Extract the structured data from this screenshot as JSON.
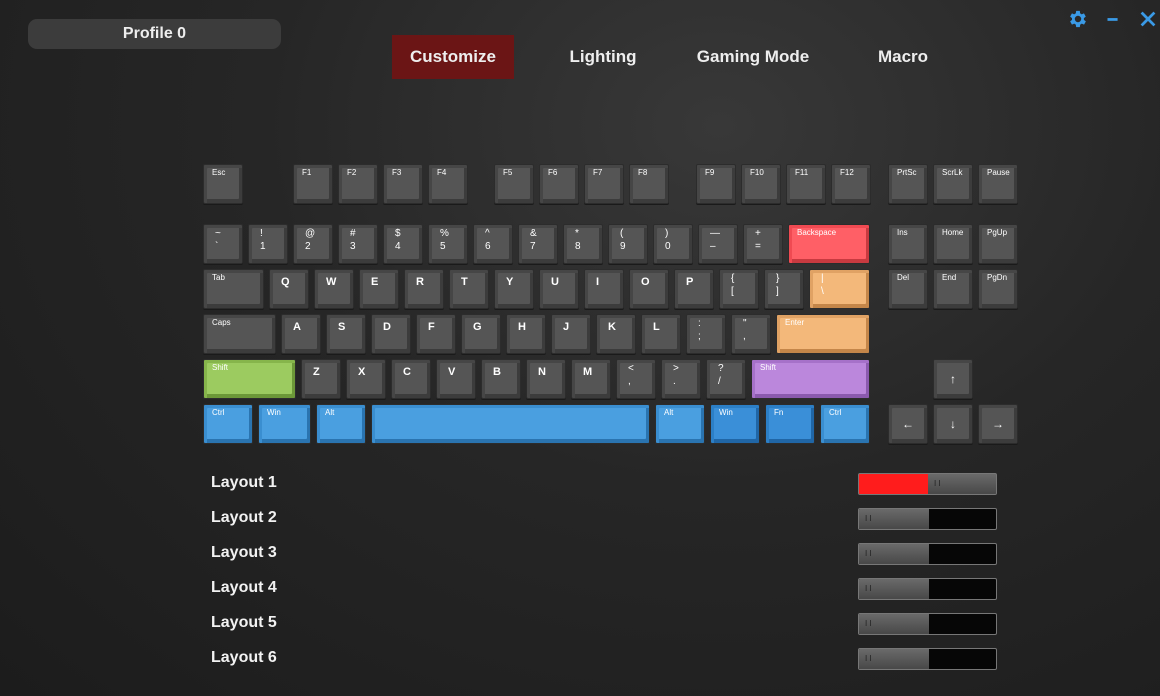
{
  "profile": {
    "name": "Profile 0"
  },
  "tabs": [
    {
      "label": "Customize",
      "active": true
    },
    {
      "label": "Lighting",
      "active": false
    },
    {
      "label": "Gaming Mode",
      "active": false
    },
    {
      "label": "Macro",
      "active": false
    }
  ],
  "window_controls": [
    "gear-icon",
    "minimize-icon",
    "close-icon"
  ],
  "colors": {
    "accent": "#6b1515",
    "toggle_on": "#ff1c1c",
    "backspace": "#ff5f66",
    "pipe_enter": "#f3b87a",
    "left_shift": "#9ccb60",
    "right_shift": "#bb87dc",
    "modifiers": "#4a9fe0"
  },
  "keyboard": {
    "function_row": [
      "Esc",
      "F1",
      "F2",
      "F3",
      "F4",
      "F5",
      "F6",
      "F7",
      "F8",
      "F9",
      "F10",
      "F11",
      "F12"
    ],
    "number_row": [
      [
        "~",
        "`"
      ],
      [
        "!",
        "1"
      ],
      [
        "@",
        "2"
      ],
      [
        "#",
        "3"
      ],
      [
        "$",
        "4"
      ],
      [
        "%",
        "5"
      ],
      [
        "^",
        "6"
      ],
      [
        "&",
        "7"
      ],
      [
        "*",
        "8"
      ],
      [
        "(",
        "9"
      ],
      [
        ")",
        "0"
      ],
      [
        "—",
        "–"
      ],
      [
        "+",
        "="
      ]
    ],
    "backspace": "Backspace",
    "tab_row": [
      "Tab",
      "Q",
      "W",
      "E",
      "R",
      "T",
      "Y",
      "U",
      "I",
      "O",
      "P"
    ],
    "brackets": [
      [
        "{",
        "["
      ],
      [
        "}",
        "]"
      ]
    ],
    "pipe": [
      "|",
      "\\"
    ],
    "caps_row": [
      "Caps",
      "A",
      "S",
      "D",
      "F",
      "G",
      "H",
      "J",
      "K",
      "L"
    ],
    "semicolon": [
      ":",
      ";"
    ],
    "quote": [
      "\"",
      ","
    ],
    "enter": "Enter",
    "shift_left": "Shift",
    "shift_row": [
      "Z",
      "X",
      "C",
      "V",
      "B",
      "N",
      "M"
    ],
    "shift_punct": [
      [
        "<",
        ","
      ],
      [
        ">",
        "."
      ],
      [
        "?",
        "/"
      ]
    ],
    "shift_right": "Shift",
    "bottom_row": [
      "Ctrl",
      "Win",
      "Alt",
      "",
      "Alt",
      "Win",
      "Fn",
      "Ctrl"
    ],
    "system_keys": [
      "PrtSc",
      "ScrLk",
      "Pause"
    ],
    "nav_keys_1": [
      "Ins",
      "Home",
      "PgUp"
    ],
    "nav_keys_2": [
      "Del",
      "End",
      "PgDn"
    ],
    "arrows": {
      "up": "↑",
      "left": "←",
      "down": "↓",
      "right": "→"
    }
  },
  "layouts": [
    {
      "label": "Layout 1",
      "enabled": true
    },
    {
      "label": "Layout 2",
      "enabled": false
    },
    {
      "label": "Layout 3",
      "enabled": false
    },
    {
      "label": "Layout 4",
      "enabled": false
    },
    {
      "label": "Layout 5",
      "enabled": false
    },
    {
      "label": "Layout 6",
      "enabled": false
    }
  ]
}
